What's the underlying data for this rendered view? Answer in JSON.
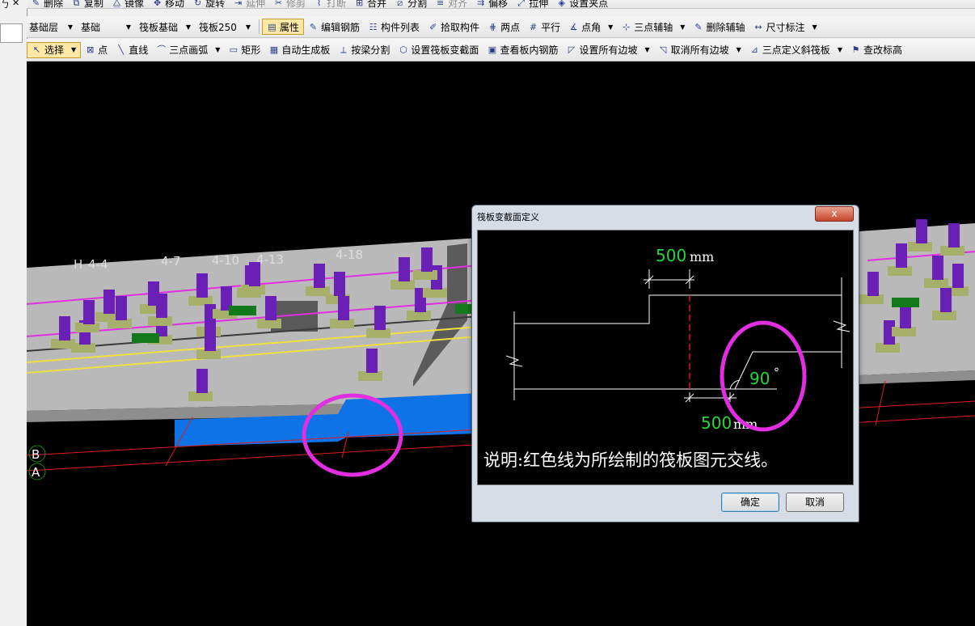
{
  "toolbar_top": {
    "items": [
      {
        "label": "删除",
        "icon": "✎"
      },
      {
        "label": "复制",
        "icon": "⧉"
      },
      {
        "label": "镜像",
        "icon": "⧋"
      },
      {
        "label": "移动",
        "icon": "✥"
      },
      {
        "label": "旋转",
        "icon": "↻"
      },
      {
        "label": "延伸",
        "icon": "⇥"
      },
      {
        "label": "修剪",
        "icon": "✂"
      },
      {
        "label": "打断",
        "icon": "⌇"
      },
      {
        "label": "合并",
        "icon": "⊞"
      },
      {
        "label": "分割",
        "icon": "⧄"
      },
      {
        "label": "对齐",
        "icon": "≡"
      },
      {
        "label": "偏移",
        "icon": "⇉"
      },
      {
        "label": "拉伸",
        "icon": "⤢"
      },
      {
        "label": "设置夹点",
        "icon": "◈"
      }
    ]
  },
  "toolbar_mid": {
    "floor_combo": "基础层",
    "category_combo": "基础",
    "type_combo": "筏板基础",
    "member_combo": "筏板250",
    "items": [
      {
        "label": "属性",
        "icon": "▤"
      },
      {
        "label": "编辑钢筋",
        "icon": "✎"
      },
      {
        "label": "构件列表",
        "icon": "☷"
      },
      {
        "label": "拾取构件",
        "icon": "✐"
      },
      {
        "label": "两点",
        "icon": "⋕"
      },
      {
        "label": "平行",
        "icon": "#"
      },
      {
        "label": "点角",
        "icon": "∡"
      },
      {
        "label": "三点辅轴",
        "icon": "⊹"
      },
      {
        "label": "删除辅轴",
        "icon": "✎"
      },
      {
        "label": "尺寸标注",
        "icon": "↔"
      }
    ]
  },
  "toolbar_draw": {
    "items": [
      {
        "label": "选择",
        "icon": "↖"
      },
      {
        "label": "点",
        "icon": "⊠"
      },
      {
        "label": "直线",
        "icon": "╲"
      },
      {
        "label": "三点画弧",
        "icon": "⌒"
      },
      {
        "label": "矩形",
        "icon": "▭"
      },
      {
        "label": "自动生成板",
        "icon": "▦"
      },
      {
        "label": "按梁分割",
        "icon": "⟂"
      },
      {
        "label": "设置筏板变截面",
        "icon": "⬡"
      },
      {
        "label": "查看板内钢筋",
        "icon": "▣"
      },
      {
        "label": "设置所有边坡",
        "icon": "◸"
      },
      {
        "label": "取消所有边坡",
        "icon": "◹"
      },
      {
        "label": "三点定义斜筏板",
        "icon": "⊿"
      },
      {
        "label": "查改标高",
        "icon": "⚑"
      }
    ]
  },
  "viewport": {
    "axis_labels": [
      "H",
      "4-4",
      "4-7",
      "4-10",
      "4-13",
      "4-18"
    ],
    "grid_labels": [
      "B",
      "A"
    ],
    "colors": {
      "slab": "#b9b9b9",
      "column": "#6a1fb6",
      "footing": "#a7b06a",
      "beam_blue": "#0e73e6",
      "highlight": "#e12ee1",
      "axis_red": "#e31b1b"
    }
  },
  "dialog": {
    "title": "筏板变截面定义",
    "close_label": "x",
    "dim_top_value": "500",
    "dim_top_unit": "mm",
    "dim_bottom_value": "500",
    "dim_bottom_unit": "mm",
    "angle_value": "90",
    "angle_unit": "°",
    "note": "说明:红色线为所绘制的筏板图元交线。",
    "ok_label": "确定",
    "cancel_label": "取消"
  }
}
